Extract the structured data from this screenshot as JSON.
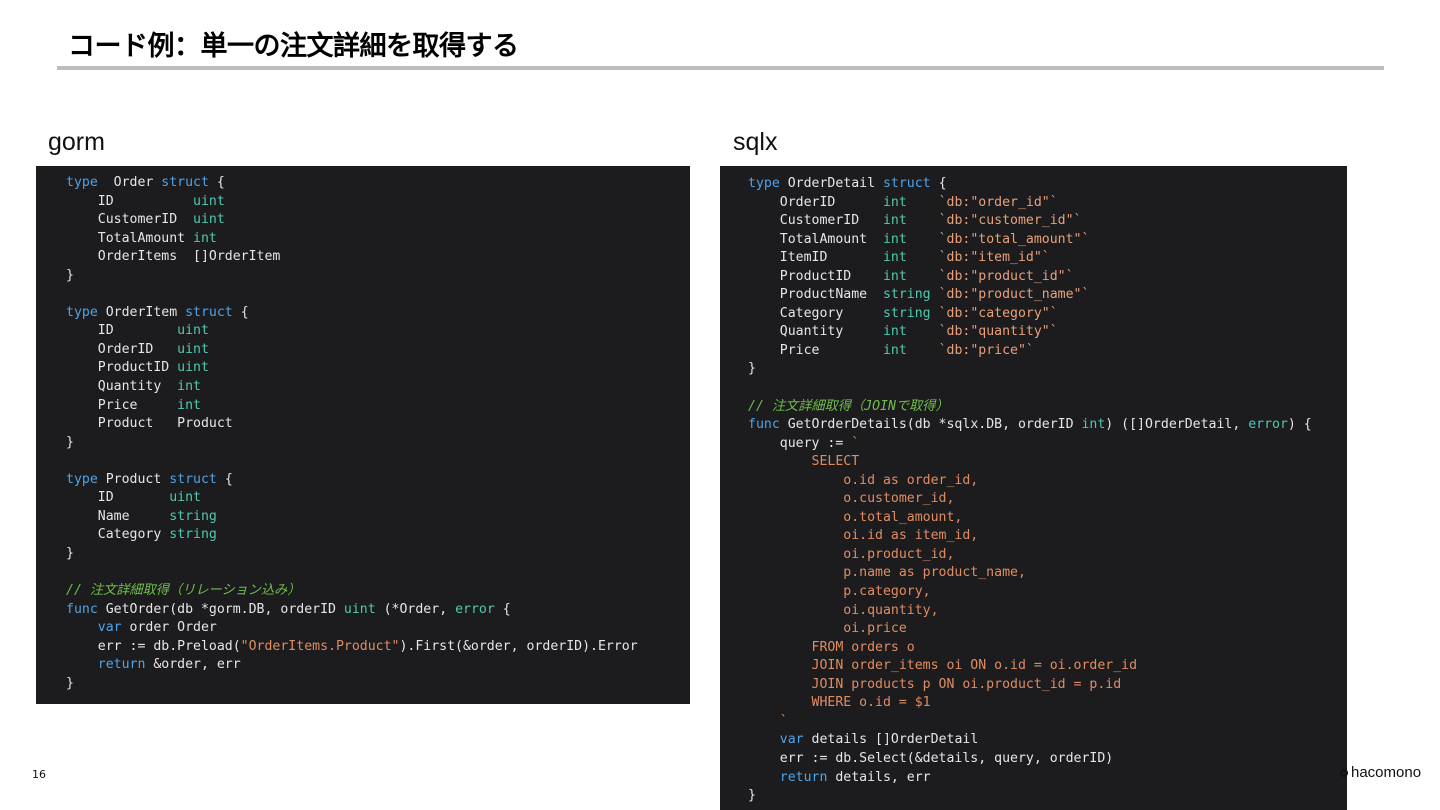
{
  "title": "コード例：単一の注文詳細を取得する",
  "left_label": "gorm",
  "right_label": "sqlx",
  "page_number": "16",
  "brand": "hacomono",
  "gorm_lines": [
    [
      [
        "kw",
        "type"
      ],
      [
        "",
        "  Order "
      ],
      [
        "kw",
        "struct"
      ],
      [
        "",
        " {"
      ]
    ],
    [
      [
        "",
        "    ID          "
      ],
      [
        "ty",
        "uint"
      ]
    ],
    [
      [
        "",
        "    CustomerID  "
      ],
      [
        "ty",
        "uint"
      ]
    ],
    [
      [
        "",
        "    TotalAmount "
      ],
      [
        "ty",
        "int"
      ]
    ],
    [
      [
        "",
        "    OrderItems  []OrderItem"
      ]
    ],
    [
      [
        "",
        "}"
      ]
    ],
    [],
    [
      [
        "kw",
        "type"
      ],
      [
        "",
        " OrderItem "
      ],
      [
        "kw",
        "struct"
      ],
      [
        "",
        " {"
      ]
    ],
    [
      [
        "",
        "    ID        "
      ],
      [
        "ty",
        "uint"
      ]
    ],
    [
      [
        "",
        "    OrderID   "
      ],
      [
        "ty",
        "uint"
      ]
    ],
    [
      [
        "",
        "    ProductID "
      ],
      [
        "ty",
        "uint"
      ]
    ],
    [
      [
        "",
        "    Quantity  "
      ],
      [
        "ty",
        "int"
      ]
    ],
    [
      [
        "",
        "    Price     "
      ],
      [
        "ty",
        "int"
      ]
    ],
    [
      [
        "",
        "    Product   Product"
      ]
    ],
    [
      [
        "",
        "}"
      ]
    ],
    [],
    [
      [
        "kw",
        "type"
      ],
      [
        "",
        " Product "
      ],
      [
        "kw",
        "struct"
      ],
      [
        "",
        " {"
      ]
    ],
    [
      [
        "",
        "    ID       "
      ],
      [
        "ty",
        "uint"
      ]
    ],
    [
      [
        "",
        "    Name     "
      ],
      [
        "ty",
        "string"
      ]
    ],
    [
      [
        "",
        "    Category "
      ],
      [
        "ty",
        "string"
      ]
    ],
    [
      [
        "",
        "}"
      ]
    ],
    [],
    [
      [
        "cm",
        "// 注文詳細取得（リレーション込み）"
      ]
    ],
    [
      [
        "kw",
        "func"
      ],
      [
        "",
        " GetOrder(db *gorm.DB, orderID "
      ],
      [
        "ty",
        "uint"
      ],
      [
        "",
        " (*Order, "
      ],
      [
        "ty",
        "error"
      ],
      [
        "",
        " {"
      ]
    ],
    [
      [
        "",
        "    "
      ],
      [
        "kw",
        "var"
      ],
      [
        "",
        " order Order"
      ]
    ],
    [
      [
        "",
        "    err := db.Preload("
      ],
      [
        "str",
        "\"OrderItems.Product\""
      ],
      [
        "",
        ").First(&order, orderID).Error"
      ]
    ],
    [
      [
        "",
        "    "
      ],
      [
        "kw",
        "return"
      ],
      [
        "",
        " &order, err"
      ]
    ],
    [
      [
        "",
        "}"
      ]
    ]
  ],
  "sqlx_lines": [
    [
      [
        "kw",
        "type"
      ],
      [
        "",
        " OrderDetail "
      ],
      [
        "kw",
        "struct"
      ],
      [
        "",
        " {"
      ]
    ],
    [
      [
        "",
        "    OrderID      "
      ],
      [
        "ty",
        "int   "
      ],
      [
        "tg",
        " `db:\"order_id\"`"
      ]
    ],
    [
      [
        "",
        "    CustomerID   "
      ],
      [
        "ty",
        "int   "
      ],
      [
        "tg",
        " `db:\"customer_id\"`"
      ]
    ],
    [
      [
        "",
        "    TotalAmount  "
      ],
      [
        "ty",
        "int   "
      ],
      [
        "tg",
        " `db:\"total_amount\"`"
      ]
    ],
    [
      [
        "",
        "    ItemID       "
      ],
      [
        "ty",
        "int   "
      ],
      [
        "tg",
        " `db:\"item_id\"`"
      ]
    ],
    [
      [
        "",
        "    ProductID    "
      ],
      [
        "ty",
        "int   "
      ],
      [
        "tg",
        " `db:\"product_id\"`"
      ]
    ],
    [
      [
        "",
        "    ProductName  "
      ],
      [
        "ty",
        "string"
      ],
      [
        "tg",
        " `db:\"product_name\"`"
      ]
    ],
    [
      [
        "",
        "    Category     "
      ],
      [
        "ty",
        "string"
      ],
      [
        "tg",
        " `db:\"category\"`"
      ]
    ],
    [
      [
        "",
        "    Quantity     "
      ],
      [
        "ty",
        "int   "
      ],
      [
        "tg",
        " `db:\"quantity\"`"
      ]
    ],
    [
      [
        "",
        "    Price        "
      ],
      [
        "ty",
        "int   "
      ],
      [
        "tg",
        " `db:\"price\"`"
      ]
    ],
    [
      [
        "",
        "}"
      ]
    ],
    [],
    [
      [
        "cm",
        "// 注文詳細取得（JOINで取得）"
      ]
    ],
    [
      [
        "kw",
        "func"
      ],
      [
        "",
        " GetOrderDetails(db *sqlx.DB, orderID "
      ],
      [
        "ty",
        "int"
      ],
      [
        "",
        ") ([]OrderDetail, "
      ],
      [
        "ty",
        "error"
      ],
      [
        "",
        ") {"
      ]
    ],
    [
      [
        "",
        "    query := "
      ],
      [
        "sql",
        "`"
      ]
    ],
    [
      [
        "sql",
        "        SELECT"
      ]
    ],
    [
      [
        "sql",
        "            o.id as order_id,"
      ]
    ],
    [
      [
        "sql",
        "            o.customer_id,"
      ]
    ],
    [
      [
        "sql",
        "            o.total_amount,"
      ]
    ],
    [
      [
        "sql",
        "            oi.id as item_id,"
      ]
    ],
    [
      [
        "sql",
        "            oi.product_id,"
      ]
    ],
    [
      [
        "sql",
        "            p.name as product_name,"
      ]
    ],
    [
      [
        "sql",
        "            p.category,"
      ]
    ],
    [
      [
        "sql",
        "            oi.quantity,"
      ]
    ],
    [
      [
        "sql",
        "            oi.price"
      ]
    ],
    [
      [
        "sql",
        "        FROM orders o"
      ]
    ],
    [
      [
        "sql",
        "        JOIN order_items oi ON o.id = oi.order_id"
      ]
    ],
    [
      [
        "sql",
        "        JOIN products p ON oi.product_id = p.id"
      ]
    ],
    [
      [
        "sql",
        "        WHERE o.id = $1"
      ]
    ],
    [
      [
        "sql",
        "    `"
      ]
    ],
    [
      [
        "",
        "    "
      ],
      [
        "kw",
        "var"
      ],
      [
        "",
        " details []OrderDetail"
      ]
    ],
    [
      [
        "",
        "    err := db.Select(&details, query, orderID)"
      ]
    ],
    [
      [
        "",
        "    "
      ],
      [
        "kw",
        "return"
      ],
      [
        "",
        " details, err"
      ]
    ],
    [
      [
        "",
        "}"
      ]
    ]
  ]
}
